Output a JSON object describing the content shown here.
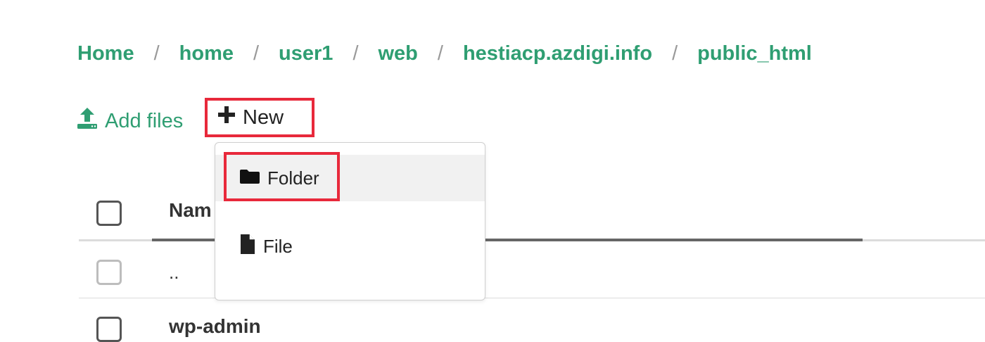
{
  "breadcrumb": [
    "Home",
    "home",
    "user1",
    "web",
    "hestiacp.azdigi.info",
    "public_html"
  ],
  "breadcrumb_separator": "/",
  "toolbar": {
    "add_files_label": "Add files",
    "new_label": "New"
  },
  "dropdown": {
    "folder_label": "Folder",
    "file_label": "File"
  },
  "table": {
    "name_header": "Nam",
    "rows": [
      "..",
      "wp-admin"
    ]
  },
  "colors": {
    "accent": "#2f9e72",
    "highlight": "#e8293b"
  },
  "icons": {
    "add_files": "upload-icon",
    "new": "plus-icon",
    "folder": "folder-icon",
    "file": "file-icon"
  }
}
